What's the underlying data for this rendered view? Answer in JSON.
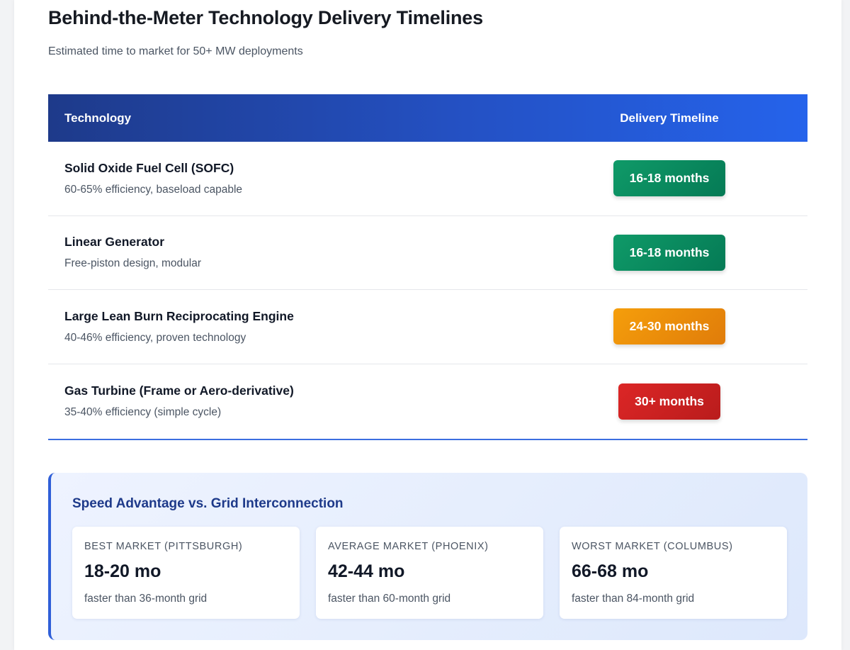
{
  "header": {
    "title": "Behind-the-Meter Technology Delivery Timelines",
    "subtitle": "Estimated time to market for 50+ MW deployments"
  },
  "table": {
    "columns": [
      "Technology",
      "Delivery Timeline"
    ],
    "rows": [
      {
        "name": "Solid Oxide Fuel Cell (SOFC)",
        "desc": "60-65% efficiency, baseload capable",
        "timeline": "16-18 months",
        "status": "green"
      },
      {
        "name": "Linear Generator",
        "desc": "Free-piston design, modular",
        "timeline": "16-18 months",
        "status": "green"
      },
      {
        "name": "Large Lean Burn Reciprocating Engine",
        "desc": "40-46% efficiency, proven technology",
        "timeline": "24-30 months",
        "status": "amber"
      },
      {
        "name": "Gas Turbine (Frame or Aero-derivative)",
        "desc": "35-40% efficiency (simple cycle)",
        "timeline": "30+ months",
        "status": "red"
      }
    ]
  },
  "speed": {
    "title": "Speed Advantage vs. Grid Interconnection",
    "cards": [
      {
        "label": "Best Market (Pittsburgh)",
        "value": "18-20 mo",
        "note": "faster than 36-month grid"
      },
      {
        "label": "Average Market (Phoenix)",
        "value": "42-44 mo",
        "note": "faster than 60-month grid"
      },
      {
        "label": "Worst Market (Columbus)",
        "value": "66-68 mo",
        "note": "faster than 84-month grid"
      }
    ]
  },
  "colors": {
    "header_start": "#1e3a8a",
    "header_end": "#2563eb",
    "green": "#057a55",
    "amber": "#f59e0b",
    "red": "#dc2626"
  }
}
